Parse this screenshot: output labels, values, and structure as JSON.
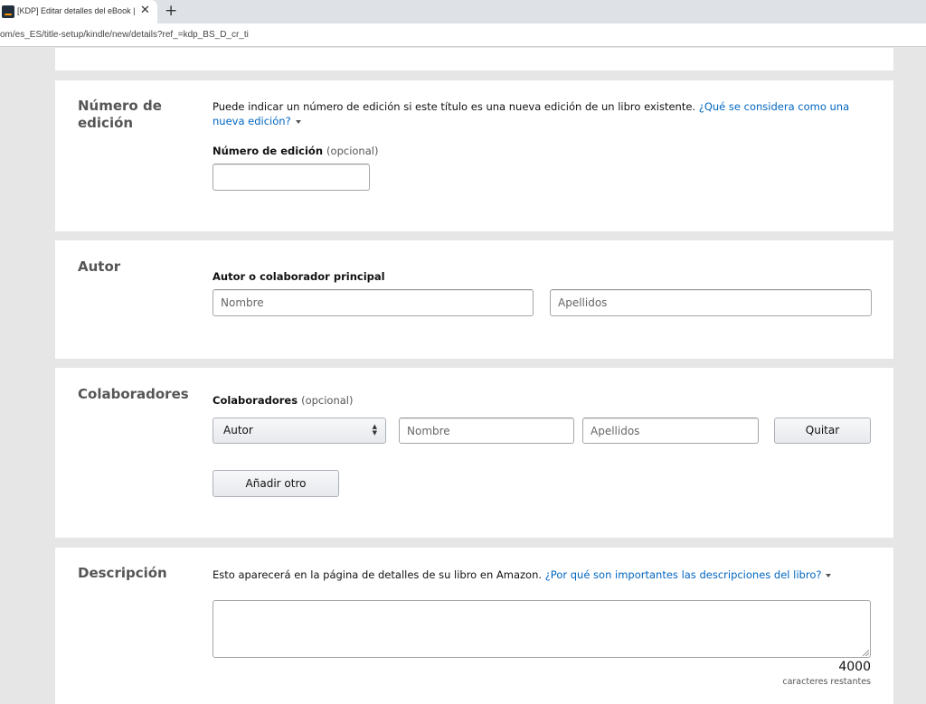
{
  "browser": {
    "tab_title": "[KDP] Editar detalles del eBook |",
    "close_glyph": "✕",
    "new_tab_glyph": "+",
    "url": "om/es_ES/title-setup/kindle/new/details?ref_=kdp_BS_D_cr_ti"
  },
  "edition": {
    "title": "Número de edición",
    "help_text": "Puede indicar un número de edición si este título es una nueva edición de un libro existente.",
    "help_link": "¿Qué se considera como una nueva edición?",
    "field_label": "Número de edición",
    "optional": "(opcional)",
    "value": ""
  },
  "author": {
    "title": "Autor",
    "field_label": "Autor o colaborador principal",
    "first_name_placeholder": "Nombre",
    "last_name_placeholder": "Apellidos"
  },
  "contributors": {
    "title": "Colaboradores",
    "field_label": "Colaboradores",
    "optional": "(opcional)",
    "role_value": "Autor",
    "role_arrows": "▲▼",
    "first_name_placeholder": "Nombre",
    "last_name_placeholder": "Apellidos",
    "remove_label": "Quitar",
    "add_label": "Añadir otro"
  },
  "description": {
    "title": "Descripción",
    "help_text": "Esto aparecerá en la página de detalles de su libro en Amazon.",
    "help_link": "¿Por qué son importantes las descripciones del libro?",
    "value": "",
    "char_count": "4000",
    "char_label": "caracteres restantes"
  },
  "colors": {
    "link": "#0066c0",
    "page_background": "#e6e6e6",
    "card_background": "#ffffff",
    "section_title": "#555555"
  }
}
